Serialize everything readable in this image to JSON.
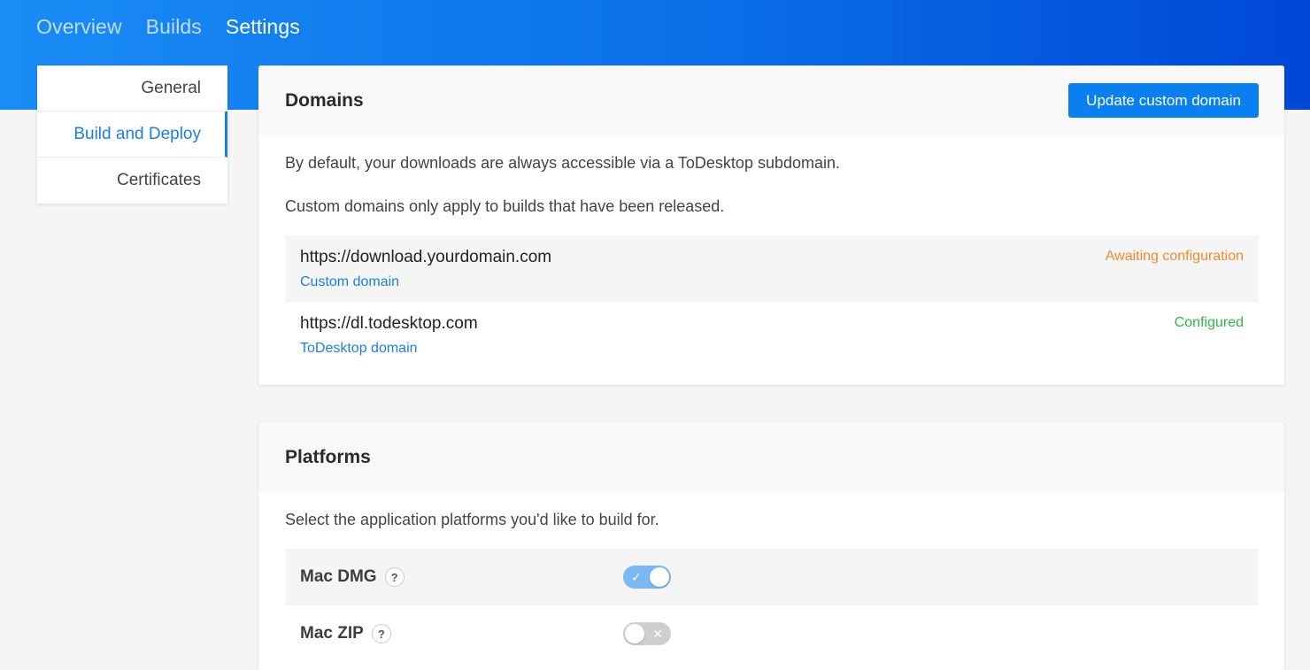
{
  "top_nav": {
    "items": [
      {
        "label": "Overview",
        "active": false
      },
      {
        "label": "Builds",
        "active": false
      },
      {
        "label": "Settings",
        "active": true
      }
    ]
  },
  "side_nav": {
    "items": [
      {
        "label": "General",
        "active": false
      },
      {
        "label": "Build and Deploy",
        "active": true
      },
      {
        "label": "Certificates",
        "active": false
      }
    ]
  },
  "domains": {
    "title": "Domains",
    "button_label": "Update custom domain",
    "description_1": "By default, your downloads are always accessible via a ToDesktop subdomain.",
    "description_2": "Custom domains only apply to builds that have been released.",
    "rows": [
      {
        "url": "https://download.yourdomain.com",
        "type": "Custom domain",
        "status": "Awaiting configuration"
      },
      {
        "url": "https://dl.todesktop.com",
        "type": "ToDesktop domain",
        "status": "Configured"
      }
    ]
  },
  "platforms": {
    "title": "Platforms",
    "description": "Select the application platforms you'd like to build for.",
    "help_glyph": "?",
    "rows": [
      {
        "label": "Mac DMG",
        "enabled": true,
        "toggle_mark": "✓"
      },
      {
        "label": "Mac ZIP",
        "enabled": false,
        "toggle_mark": "✕"
      }
    ]
  },
  "colors": {
    "accent": "#0a80f0",
    "awaiting": "#f08a28",
    "configured": "#2eb83e"
  }
}
